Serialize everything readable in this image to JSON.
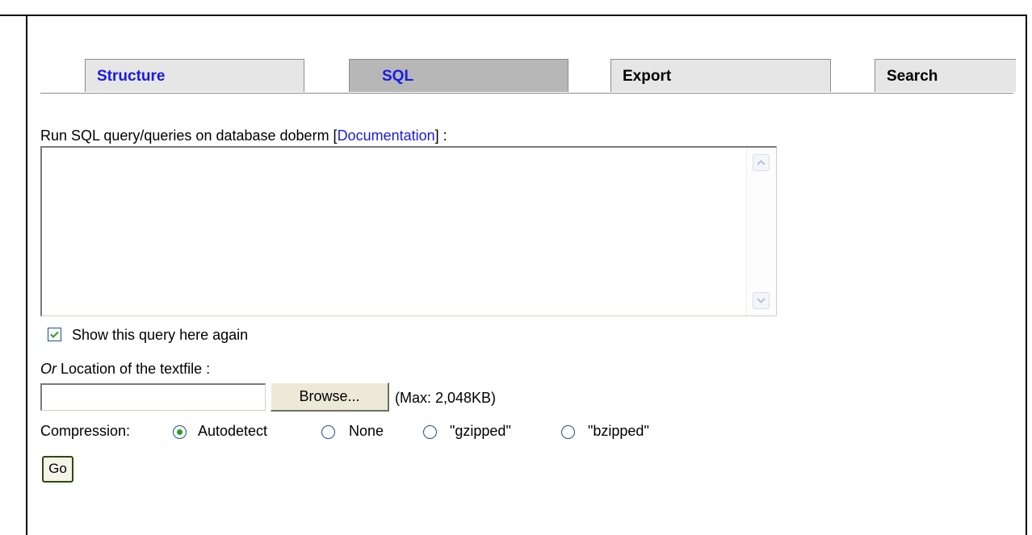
{
  "tabs": [
    {
      "label": "Structure"
    },
    {
      "label": "SQL"
    },
    {
      "label": "Export"
    },
    {
      "label": "Search"
    }
  ],
  "active_tab": "SQL",
  "query_section": {
    "prefix": "Run SQL query/queries on database doberm [",
    "doc_link": "Documentation",
    "suffix": "] :",
    "query_value": ""
  },
  "show_query": {
    "label": "Show this query here again",
    "checked": true
  },
  "textfile": {
    "or_label": "Or",
    "location_label": " Location of the textfile :",
    "value": "",
    "browse_label": "Browse...",
    "max_label": "(Max: 2,048KB)"
  },
  "compression": {
    "label": "Compression:",
    "options": [
      "Autodetect",
      "None",
      "\"gzipped\"",
      "\"bzipped\""
    ],
    "selected": "Autodetect"
  },
  "go_label": "Go",
  "colors": {
    "link": "#1a1ae6",
    "active_tab_bg": "#b7b7b7",
    "tab_bg": "#e6e6e6",
    "check_green": "#21a121"
  },
  "icons": {
    "scroll_up": "chevron-up-icon",
    "scroll_down": "chevron-down-icon",
    "checkmark": "checkmark-icon"
  }
}
